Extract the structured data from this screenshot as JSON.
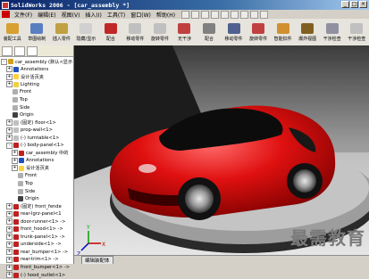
{
  "window": {
    "title": "SolidWorks 2006 - [car_assembly *]",
    "min_label": "_",
    "max_label": "□",
    "close_label": "×"
  },
  "menubar": {
    "items": [
      "文件(F)",
      "编辑(E)",
      "视图(V)",
      "插入(I)",
      "工具(T)",
      "窗口(W)",
      "帮助(H)"
    ]
  },
  "toolbar": {
    "items": [
      {
        "label": "装配工具",
        "icon": "assembly-icon",
        "color": "#d8a030"
      },
      {
        "label": "草图绘制",
        "icon": "sketch-icon",
        "color": "#5a7fc0"
      },
      {
        "label": "插入零件",
        "icon": "insert-part-icon",
        "color": "#c0a040"
      },
      {
        "label": "隐藏/显示",
        "icon": "show-hide-icon",
        "color": "#d0d0d0"
      },
      {
        "label": "配合",
        "icon": "mate-icon",
        "color": "#c02828"
      },
      {
        "label": "移动零件",
        "icon": "move-icon",
        "color": "#c0c0c0"
      },
      {
        "label": "旋转零件",
        "icon": "rotate-icon",
        "color": "#c0c0c0"
      },
      {
        "label": "无干涉",
        "icon": "interference-icon",
        "color": "#c04040"
      },
      {
        "label": "配合",
        "icon": "mate2-icon",
        "color": "#808080"
      },
      {
        "label": "移动零件",
        "icon": "move-component-icon",
        "color": "#506090"
      },
      {
        "label": "旋转零件",
        "icon": "rotate-component-icon",
        "color": "#c04040"
      },
      {
        "label": "智能扣件",
        "icon": "smart-fastener-icon",
        "color": "#d09030"
      },
      {
        "label": "爆炸视图",
        "icon": "explode-icon",
        "color": "#806020"
      },
      {
        "label": "干涉检查",
        "icon": "interference-check-icon",
        "color": "#9090a0"
      },
      {
        "label": "干涉检查",
        "icon": "clearance-icon",
        "color": "#c0c0c0"
      }
    ]
  },
  "feature_tree": [
    {
      "label": "car_assembly  (默认<显示",
      "exp": "-",
      "color": "#d0a020"
    },
    {
      "label": "Annotations",
      "exp": "+",
      "color": "#2050c0"
    },
    {
      "label": "设计活页夹",
      "exp": "+",
      "color": "#ffd040"
    },
    {
      "label": "Lighting",
      "exp": "+",
      "color": "#f0d040"
    },
    {
      "label": "Front",
      "exp": "",
      "color": "#b0b0b0"
    },
    {
      "label": "Top",
      "exp": "",
      "color": "#b0b0b0"
    },
    {
      "label": "Side",
      "exp": "",
      "color": "#b0b0b0"
    },
    {
      "label": "Origin",
      "exp": "",
      "color": "#404040"
    },
    {
      "label": "(固定) floor<1>",
      "exp": "+",
      "color": "#c0c0c0"
    },
    {
      "label": "prop-wall<1>",
      "exp": "+",
      "color": "#c0c0c0"
    },
    {
      "label": "(-) turntable<1>",
      "exp": "+",
      "color": "#c0c0c0"
    },
    {
      "label": "(-) body-panel<1>",
      "exp": "-",
      "color": "#c02020"
    },
    {
      "label": "car_assembly 中的",
      "exp": "+",
      "color": "#c02020"
    },
    {
      "label": "Annotations",
      "exp": "+",
      "color": "#2050c0"
    },
    {
      "label": "设计活页夹",
      "exp": "+",
      "color": "#ffd040"
    },
    {
      "label": "Front",
      "exp": "",
      "color": "#b0b0b0"
    },
    {
      "label": "Top",
      "exp": "",
      "color": "#b0b0b0"
    },
    {
      "label": "Side",
      "exp": "",
      "color": "#b0b0b0"
    },
    {
      "label": "Origin",
      "exp": "",
      "color": "#404040"
    },
    {
      "label": "(固定) front_fende",
      "exp": "+",
      "color": "#c02020"
    },
    {
      "label": "rear-lgrz-panel<1",
      "exp": "+",
      "color": "#c02020"
    },
    {
      "label": "door-runner<1> ->",
      "exp": "+",
      "color": "#c02020"
    },
    {
      "label": "front_hood<1> ->",
      "exp": "+",
      "color": "#c02020"
    },
    {
      "label": "trunk-panel<1> ->",
      "exp": "+",
      "color": "#c02020"
    },
    {
      "label": "underside<1> ->",
      "exp": "+",
      "color": "#c02020"
    },
    {
      "label": "rear_bumper<1> ->",
      "exp": "+",
      "color": "#c02020"
    },
    {
      "label": "rear-trim<1> ->",
      "exp": "+",
      "color": "#c02020"
    },
    {
      "label": "front_bumper<1> ->",
      "exp": "+",
      "color": "#c02020"
    },
    {
      "label": "(-) hood_outlet<1>",
      "exp": "+",
      "color": "#c02020"
    }
  ],
  "viewport": {
    "watermark": "最需教育",
    "status_text": "编辑装配体",
    "triad": {
      "x": "X",
      "y": "Y",
      "z": "Z"
    },
    "car_color": "#e01010"
  }
}
